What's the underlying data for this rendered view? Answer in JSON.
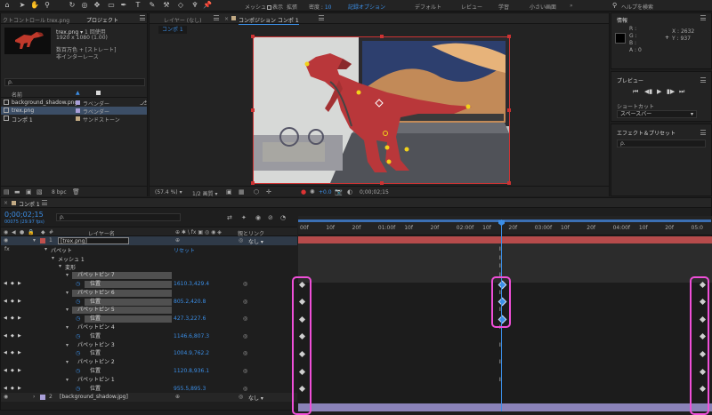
{
  "toolbar": {
    "workspaces": [
      "メッシュ",
      "表示",
      "拡張",
      "密度",
      "記録オプション",
      "デフォルト",
      "レビュー",
      "学習",
      "小さい画面"
    ],
    "density_value": "10",
    "help_placeholder": "ヘルプを検索"
  },
  "project": {
    "tabs": [
      "クトコントロール trex.png",
      "プロジェクト"
    ],
    "preview_name": "trex.png",
    "usage": "1 回使用",
    "resolution": "1920 x 1080 (1.00)",
    "color": "数百万色 + [ストレート]",
    "interlace": "非インターレース",
    "search_placeholder": "ρ.",
    "col_name": "名前",
    "col_label": "",
    "items": [
      {
        "name": "background_shadow.png",
        "label": "ラベンダー",
        "color": "#a99fd8"
      },
      {
        "name": "trex.png",
        "label": "ラベンダー",
        "color": "#a99fd8"
      },
      {
        "name": "コンポ 1",
        "label": "サンドストーン",
        "color": "#c2aa84"
      }
    ],
    "bpc": "8 bpc"
  },
  "comp_viewer": {
    "tabs": [
      "レイヤー (なし)",
      "コンポジション コンポ 1"
    ],
    "breadcrumb": "コンポ 1",
    "zoom": "(57.4 %)",
    "quality": "1/2 画質",
    "exposure": "+0.0",
    "timecode": "0;00;02;15"
  },
  "info": {
    "title": "情報",
    "r": "R :",
    "g": "G :",
    "b": "B :",
    "a": "A : 0",
    "x": "X : 2632",
    "y": "Y : 937"
  },
  "preview": {
    "title": "プレビュー",
    "shortcut_label": "ショートカット",
    "shortcut_value": "スペースバー"
  },
  "effects": {
    "title": "エフェクト＆プリセット",
    "search_placeholder": "ρ."
  },
  "timeline": {
    "tab": "コンポ 1",
    "timecode": "0;00;02;15",
    "fps": "00075 (29.97 fps)",
    "search_placeholder": "ρ.",
    "header_layer": "レイヤー名",
    "header_parent": "親とリンク",
    "ruler": [
      "00f",
      "10f",
      "20f",
      "01:00f",
      "10f",
      "20f",
      "02:00f",
      "10f",
      "20f",
      "03:00f",
      "10f",
      "20f",
      "04:00f",
      "10f",
      "20f",
      "05:0"
    ],
    "rows": [
      {
        "indent": 0,
        "num": "1",
        "name": "[trex.png]",
        "value": "",
        "parent": "なし",
        "type": "layer"
      },
      {
        "indent": 1,
        "name": "パペット",
        "value": "リセット",
        "type": "group"
      },
      {
        "indent": 2,
        "name": "メッシュ 1",
        "value": "",
        "type": "group"
      },
      {
        "indent": 3,
        "name": "変形",
        "value": "",
        "type": "group"
      },
      {
        "indent": 4,
        "name": "パペットピン 7",
        "value": "",
        "type": "pin",
        "hl": true
      },
      {
        "indent": 5,
        "name": "位置",
        "value": "1610.3,429.4",
        "type": "pos",
        "kf": true
      },
      {
        "indent": 4,
        "name": "パペットピン 6",
        "value": "",
        "type": "pin",
        "hl": true
      },
      {
        "indent": 5,
        "name": "位置",
        "value": "805.2,420.8",
        "type": "pos",
        "kf": true
      },
      {
        "indent": 4,
        "name": "パペットピン 5",
        "value": "",
        "type": "pin",
        "hl": true
      },
      {
        "indent": 5,
        "name": "位置",
        "value": "427.3,227.6",
        "type": "pos",
        "kf": true
      },
      {
        "indent": 4,
        "name": "パペットピン 4",
        "value": "",
        "type": "pin"
      },
      {
        "indent": 5,
        "name": "位置",
        "value": "1146.6,807.3",
        "type": "pos",
        "kf": true
      },
      {
        "indent": 4,
        "name": "パペットピン 3",
        "value": "",
        "type": "pin"
      },
      {
        "indent": 5,
        "name": "位置",
        "value": "1004.9,762.2",
        "type": "pos",
        "kf": true
      },
      {
        "indent": 4,
        "name": "パペットピン 2",
        "value": "",
        "type": "pin"
      },
      {
        "indent": 5,
        "name": "位置",
        "value": "1120.8,936.1",
        "type": "pos",
        "kf": true
      },
      {
        "indent": 4,
        "name": "パペットピン 1",
        "value": "",
        "type": "pin"
      },
      {
        "indent": 5,
        "name": "位置",
        "value": "955.5,895.3",
        "type": "pos",
        "kf": true
      },
      {
        "indent": 0,
        "num": "2",
        "name": "[background_shadow.jpg]",
        "value": "",
        "parent": "なし",
        "type": "layer"
      }
    ],
    "playhead_time": "02:15"
  }
}
